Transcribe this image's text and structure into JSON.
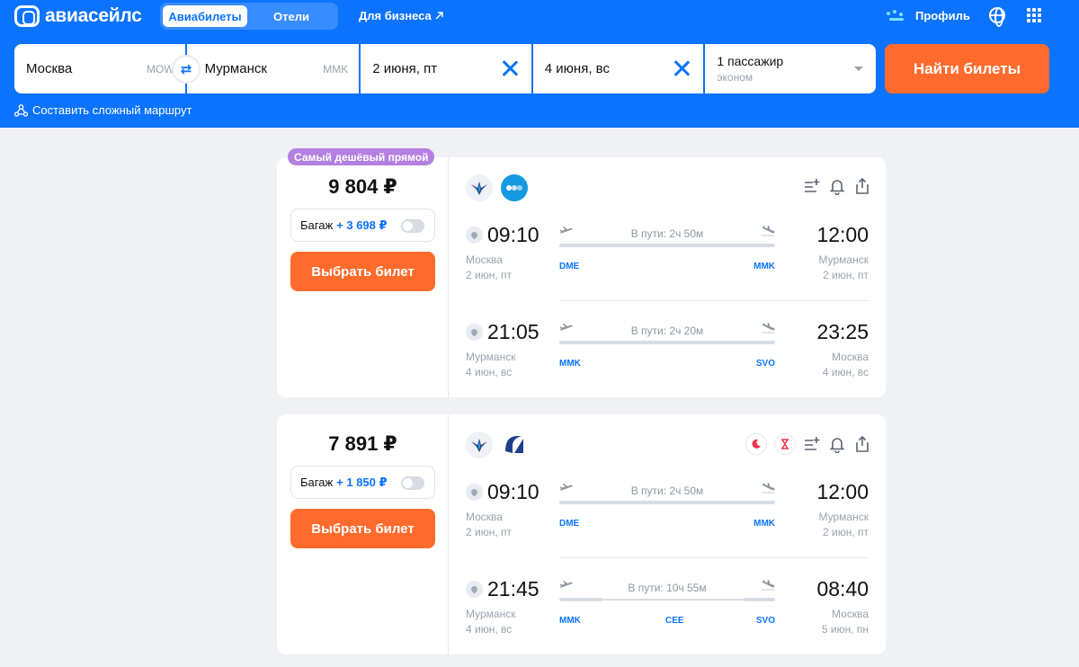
{
  "header": {
    "logo_text": "авиасейлс",
    "tabs": [
      {
        "label": "Авиабилеты"
      },
      {
        "label": "Отели"
      }
    ],
    "business_link": "Для бизнеса",
    "profile_label": "Профиль"
  },
  "search": {
    "from_city": "Москва",
    "from_code": "MOW",
    "to_city": "Мурманск",
    "to_code": "MMK",
    "depart_date": "2 июня, пт",
    "return_date": "4 июня, вс",
    "passengers": "1 пассажир",
    "cabin": "эконом",
    "find_button": "Найти билеты",
    "complex_route": "Составить сложный маршрут"
  },
  "colors": {
    "brand_blue": "#0c73fe",
    "cta_orange": "#ff6b2c",
    "badge_purple": "#b37fe0"
  },
  "tickets": [
    {
      "badge": "Самый дешёвый прямой",
      "price": "9 804 ₽",
      "baggage_label": "Багаж",
      "baggage_price": "+ 3 698 ₽",
      "select_button": "Выбрать билет",
      "segments": [
        {
          "dep_time": "09:10",
          "arr_time": "12:00",
          "duration": "В пути: 2ч 50м",
          "dep_city": "Москва",
          "dep_date": "2 июн, пт",
          "arr_city": "Мурманск",
          "arr_date": "2 июн, пт",
          "dep_airport": "DME",
          "arr_airport": "MMK"
        },
        {
          "dep_time": "21:05",
          "arr_time": "23:25",
          "duration": "В пути: 2ч 20м",
          "dep_city": "Мурманск",
          "dep_date": "4 июн, вс",
          "arr_city": "Москва",
          "arr_date": "4 июн, вс",
          "dep_airport": "MMK",
          "arr_airport": "SVO"
        }
      ]
    },
    {
      "price": "7 891 ₽",
      "baggage_label": "Багаж",
      "baggage_price": "+ 1 850 ₽",
      "select_button": "Выбрать билет",
      "segments": [
        {
          "dep_time": "09:10",
          "arr_time": "12:00",
          "duration": "В пути: 2ч 50м",
          "dep_city": "Москва",
          "dep_date": "2 июн, пт",
          "arr_city": "Мурманск",
          "arr_date": "2 июн, пт",
          "dep_airport": "DME",
          "arr_airport": "MMK"
        },
        {
          "dep_time": "21:45",
          "arr_time": "08:40",
          "duration": "В пути: 10ч 55м",
          "dep_city": "Мурманск",
          "dep_date": "4 июн, вс",
          "arr_city": "Москва",
          "arr_date": "5 июн, пн",
          "dep_airport": "MMK",
          "stop_airport": "CEE",
          "arr_airport": "SVO"
        }
      ]
    }
  ]
}
